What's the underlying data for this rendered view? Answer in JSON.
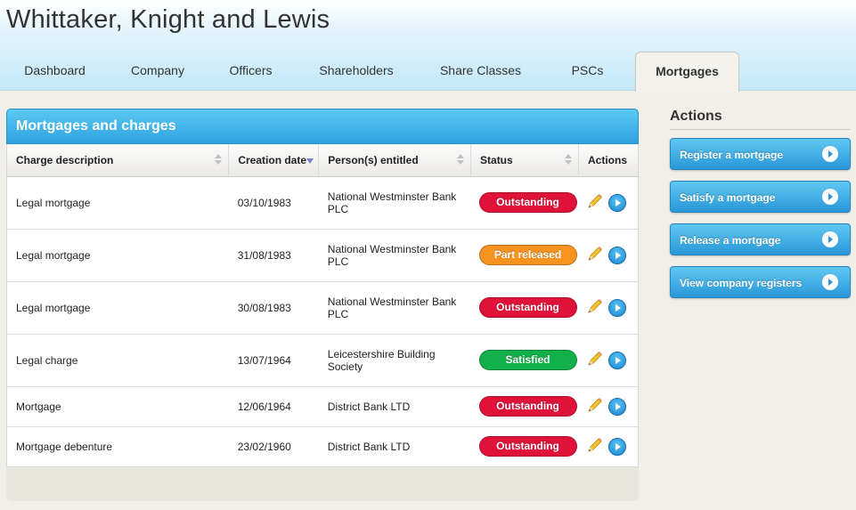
{
  "company": {
    "name": "Whittaker, Knight and Lewis"
  },
  "tabs": [
    {
      "label": "Dashboard"
    },
    {
      "label": "Company"
    },
    {
      "label": "Officers"
    },
    {
      "label": "Shareholders"
    },
    {
      "label": "Share Classes"
    },
    {
      "label": "PSCs"
    },
    {
      "label": "Mortgages",
      "active": true
    }
  ],
  "panel": {
    "title": "Mortgages and charges",
    "columns": {
      "description": "Charge description",
      "date": "Creation date",
      "persons": "Person(s) entitled",
      "status": "Status",
      "actions": "Actions"
    },
    "rows": [
      {
        "description": "Legal mortgage",
        "date": "03/10/1983",
        "persons": "National Westminster Bank PLC",
        "status": "Outstanding"
      },
      {
        "description": "Legal mortgage",
        "date": "31/08/1983",
        "persons": "National Westminster Bank PLC",
        "status": "Part released"
      },
      {
        "description": "Legal mortgage",
        "date": "30/08/1983",
        "persons": "National Westminster Bank PLC",
        "status": "Outstanding"
      },
      {
        "description": "Legal charge",
        "date": "13/07/1964",
        "persons": "Leicestershire Building Society",
        "status": "Satisfied"
      },
      {
        "description": "Mortgage",
        "date": "12/06/1964",
        "persons": "District Bank LTD",
        "status": "Outstanding"
      },
      {
        "description": "Mortgage debenture",
        "date": "23/02/1960",
        "persons": "District Bank LTD",
        "status": "Outstanding"
      }
    ]
  },
  "sidebar": {
    "heading": "Actions",
    "buttons": [
      {
        "label": "Register a mortgage"
      },
      {
        "label": "Satisfy a mortgage"
      },
      {
        "label": "Release a mortgage"
      },
      {
        "label": "View company registers"
      }
    ]
  },
  "colors": {
    "outstanding": "#e0123a",
    "part_released": "#f7931e",
    "satisfied": "#12b04a",
    "accent": "#2fa3e0"
  },
  "icons": {
    "edit": "pencil-icon",
    "view": "arrow-circle-icon"
  }
}
